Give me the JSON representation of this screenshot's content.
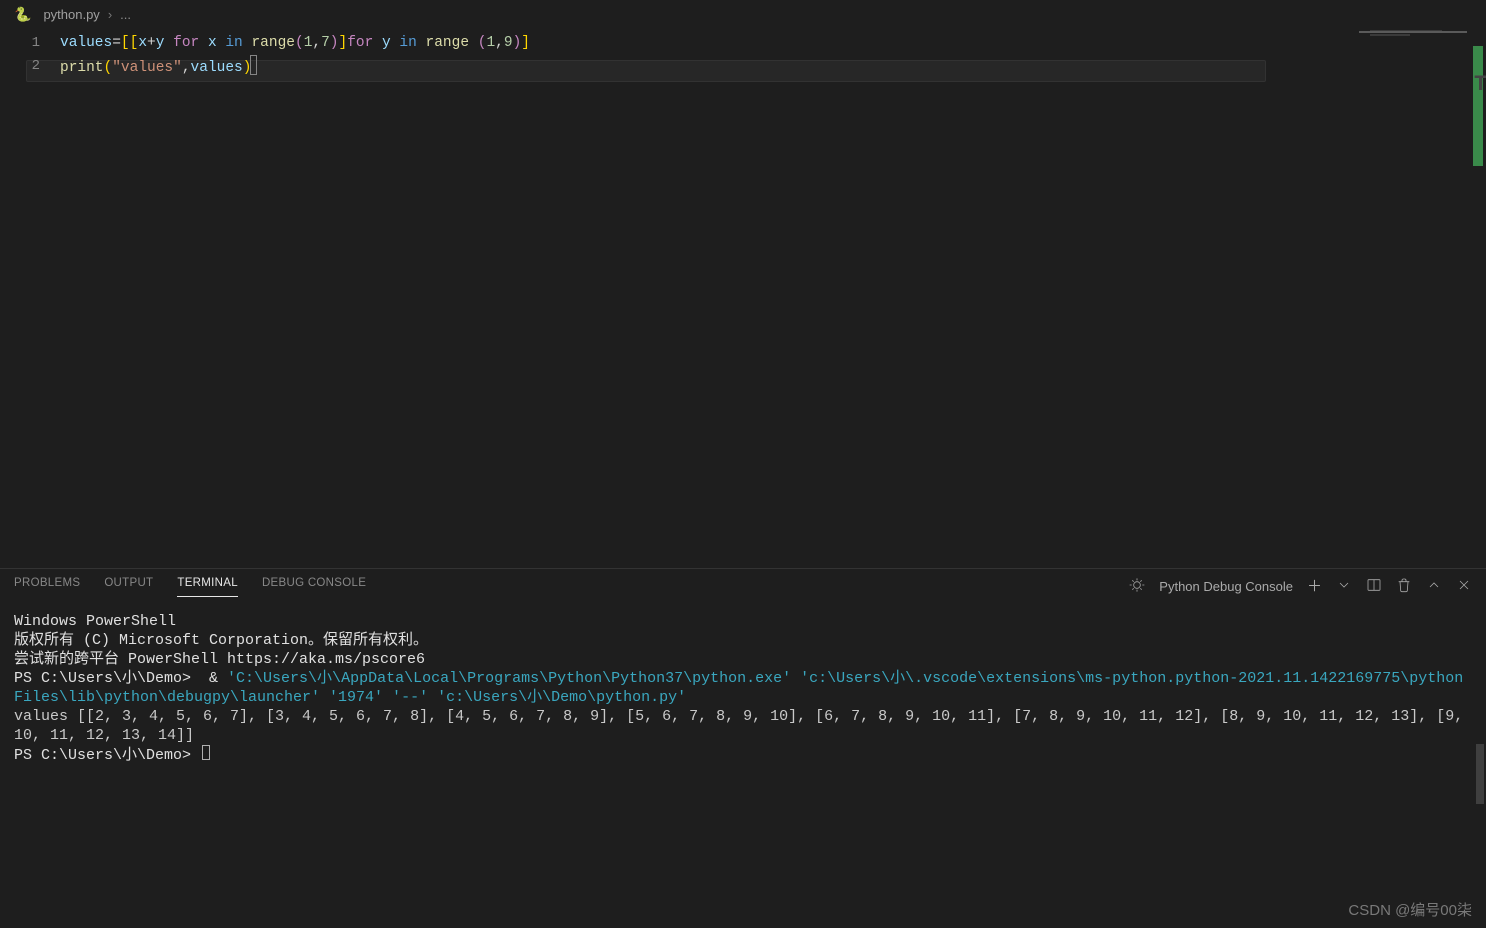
{
  "breadcrumb": {
    "file_name": "python.py",
    "context": "..."
  },
  "editor": {
    "lines": [
      {
        "number": "1"
      },
      {
        "number": "2"
      }
    ],
    "code": {
      "l1": {
        "var": "values",
        "eq": "=",
        "lb1": "[[",
        "xy_x": "x",
        "plus": "+",
        "xy_y": "y",
        "sp1": " ",
        "for1": "for",
        "x2": "x",
        "in1": "in",
        "range1": "range",
        "lp1": "(",
        "a1": "1",
        "c1": ",",
        "a7": "7",
        "rp1": ")",
        "rb1": "]",
        "for2": "for",
        "y2": "y",
        "in2": "in",
        "range2": "range",
        "lp2": " (",
        "b1": "1",
        "c2": ",",
        "b9": "9",
        "rp2": ")",
        "rb2": "]"
      },
      "l2": {
        "fn": "print",
        "lp": "(",
        "str": "\"values\"",
        "comma": ",",
        "var": "values",
        "rp": ")"
      }
    }
  },
  "panel": {
    "tabs": {
      "problems": "PROBLEMS",
      "output": "OUTPUT",
      "terminal": "TERMINAL",
      "debug_console": "DEBUG CONSOLE"
    },
    "actions": {
      "kind_label": "Python Debug Console"
    }
  },
  "terminal": {
    "l1": "Windows PowerShell",
    "l2": "版权所有 (C) Microsoft Corporation。保留所有权利。",
    "l3": "",
    "l4": "尝试新的跨平台 PowerShell https://aka.ms/pscore6",
    "l5": "",
    "prompt1_pre": "PS C:\\Users\\小\\Demo>  & ",
    "cmd": "'C:\\Users\\小\\AppData\\Local\\Programs\\Python\\Python37\\python.exe' 'c:\\Users\\小\\.vscode\\extensions\\ms-python.python-2021.11.1422169775\\pythonFiles\\lib\\python\\debugpy\\launcher' '1974' '--' 'c:\\Users\\小\\Demo\\python.py'",
    "output1": "values [[2, 3, 4, 5, 6, 7], [3, 4, 5, 6, 7, 8], [4, 5, 6, 7, 8, 9], [5, 6, 7, 8, 9, 10], [6, 7, 8, 9, 10, 11], [7, 8, 9, 10, 11, 12], [8, 9, 10, 11, 12, 13], [9, 10, 11, 12, 13, 14]]",
    "prompt2": "PS C:\\Users\\小\\Demo> "
  },
  "watermark": "CSDN @编号00柒"
}
